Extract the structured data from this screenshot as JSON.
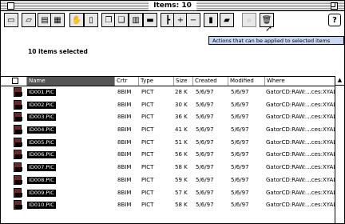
{
  "window": {
    "title": "Items: 10"
  },
  "toolbar": {
    "buttons": [
      {
        "icon": "view-icon",
        "glyph": "▭"
      },
      {
        "icon": "folder-icon",
        "glyph": "▱"
      },
      {
        "icon": "document-icon",
        "glyph": "▤"
      },
      {
        "icon": "print-icon",
        "glyph": "▦"
      },
      {
        "icon": "hand-icon",
        "glyph": "✋"
      },
      {
        "icon": "file-icon",
        "glyph": "▯"
      },
      {
        "icon": "copy-icon",
        "glyph": "❐"
      },
      {
        "icon": "duplicate-icon",
        "glyph": "❑"
      },
      {
        "icon": "pages-icon",
        "glyph": "▥"
      },
      {
        "icon": "list-icon",
        "glyph": "▬"
      },
      {
        "icon": "add-before-icon",
        "glyph": "┣"
      },
      {
        "icon": "add-icon",
        "glyph": "+"
      },
      {
        "icon": "remove-icon",
        "glyph": "−"
      },
      {
        "icon": "tag-icon",
        "glyph": "▮"
      },
      {
        "icon": "actions-icon",
        "glyph": "▰"
      },
      {
        "icon": "find-icon",
        "glyph": "⌕"
      },
      {
        "icon": "trash-icon",
        "glyph": "🗑"
      }
    ],
    "help_label": "?"
  },
  "tooltip": "Actions that can be applied to selected items",
  "selection_info": "10 items selected",
  "columns": [
    "Name",
    "Crtr",
    "Type",
    "Size",
    "Created",
    "Modified",
    "Where"
  ],
  "rows": [
    {
      "name": "ID001.PIC",
      "crtr": "8BIM",
      "type": "PICT",
      "size": "28 K",
      "created": "5/6/97",
      "modified": "5/6/97",
      "where": "GatorCD:RAW:...ces:XYALH:"
    },
    {
      "name": "ID002.PIC",
      "crtr": "8BIM",
      "type": "PICT",
      "size": "30 K",
      "created": "5/6/97",
      "modified": "5/6/97",
      "where": "GatorCD:RAW:...ces:XYALH:"
    },
    {
      "name": "ID003.PIC",
      "crtr": "8BIM",
      "type": "PICT",
      "size": "36 K",
      "created": "5/6/97",
      "modified": "5/6/97",
      "where": "GatorCD:RAW:...ces:XYALH:"
    },
    {
      "name": "ID004.PIC",
      "crtr": "8BIM",
      "type": "PICT",
      "size": "41 K",
      "created": "5/6/97",
      "modified": "5/6/97",
      "where": "GatorCD:RAW:...ces:XYALH:"
    },
    {
      "name": "ID005.PIC",
      "crtr": "8BIM",
      "type": "PICT",
      "size": "51 K",
      "created": "5/6/97",
      "modified": "5/6/97",
      "where": "GatorCD:RAW:...ces:XYALH:"
    },
    {
      "name": "ID006.PIC",
      "crtr": "8BIM",
      "type": "PICT",
      "size": "56 K",
      "created": "5/6/97",
      "modified": "5/6/97",
      "where": "GatorCD:RAW:...ces:XYALH:"
    },
    {
      "name": "ID007.PIC",
      "crtr": "8BIM",
      "type": "PICT",
      "size": "58 K",
      "created": "5/6/97",
      "modified": "5/6/97",
      "where": "GatorCD:RAW:...ces:XYALH:"
    },
    {
      "name": "ID008.PIC",
      "crtr": "8BIM",
      "type": "PICT",
      "size": "59 K",
      "created": "5/6/97",
      "modified": "5/6/97",
      "where": "GatorCD:RAW:...ces:XYALH:"
    },
    {
      "name": "ID009.PIC",
      "crtr": "8BIM",
      "type": "PICT",
      "size": "57 K",
      "created": "5/6/97",
      "modified": "5/6/97",
      "where": "GatorCD:RAW:...ces:XYALH:"
    },
    {
      "name": "ID010.PIC",
      "crtr": "8BIM",
      "type": "PICT",
      "size": "58 K",
      "created": "5/6/97",
      "modified": "5/6/97",
      "where": "GatorCD:RAW:...ces:XYALH:"
    }
  ]
}
